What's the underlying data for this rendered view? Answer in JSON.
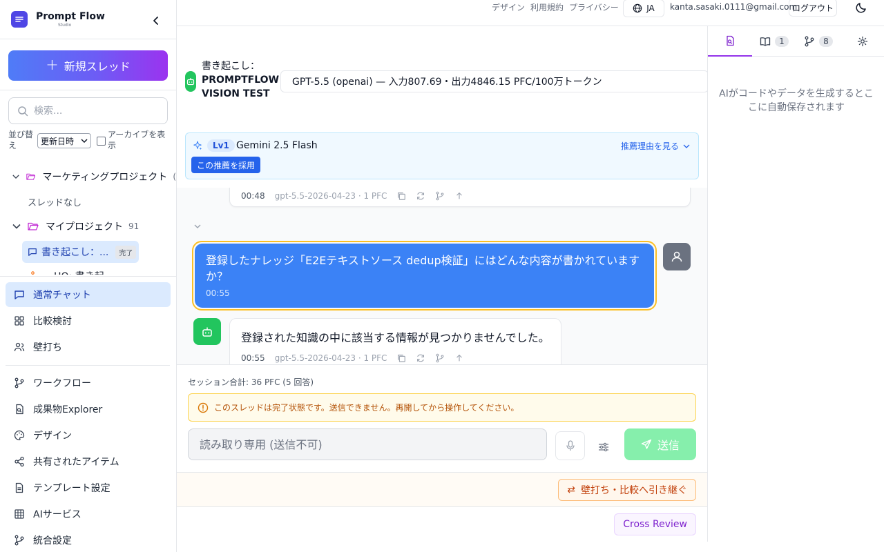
{
  "brand": {
    "name": "Prompt Flow",
    "sub": "Studio"
  },
  "sidebar": {
    "new_thread": "新規スレッド",
    "search_placeholder": "検索...",
    "sort_label": "並び替え",
    "sort_value": "更新日時",
    "archive_label": "アーカイブを表示",
    "tree": {
      "project1": {
        "name": "マーケティングプロジェクト",
        "suffix": "("
      },
      "project1_empty": "スレッドなし",
      "project2": {
        "name": "マイプロジェクト",
        "count": "91"
      },
      "active_thread": {
        "label": "書き起こし：...",
        "status": "完了"
      },
      "partial_row": "HQ: 書き起"
    },
    "nav": [
      {
        "label": "通常チャット",
        "icon": "chat-icon"
      },
      {
        "label": "比較検討",
        "icon": "grid-icon"
      },
      {
        "label": "壁打ち",
        "icon": "users-icon"
      },
      {
        "label": "ワークフロー",
        "icon": "workflow-icon"
      },
      {
        "label": "成果物Explorer",
        "icon": "file-search-icon"
      },
      {
        "label": "デザイン",
        "icon": "palette-icon"
      },
      {
        "label": "共有されたアイテム",
        "icon": "share-icon"
      },
      {
        "label": "テンプレート設定",
        "icon": "document-icon"
      },
      {
        "label": "AIサービス",
        "icon": "table-icon"
      },
      {
        "label": "統合設定",
        "icon": "branch-icon"
      }
    ]
  },
  "topbar": {
    "links": [
      "デザイン",
      "利用規約",
      "プライバシー"
    ],
    "lang": "JA",
    "email": "kanta.sasaki.0111@gmail.com",
    "logout": "ログアウト"
  },
  "thread": {
    "title_prefix": "書き起こし：",
    "title_main": "PROMPTFLOW VISION TEST",
    "model": "GPT-5.5 (openai) — 入力807.69・出力4846.15 PFC/100万トークン"
  },
  "recommendation": {
    "level": "Lv1",
    "model": "Gemini 2.5 Flash",
    "reason_link": "推薦理由を見る",
    "adopt": "この推薦を採用"
  },
  "messages": {
    "prev_meta": {
      "time": "00:48",
      "info": "gpt-5.5-2026-04-23 · 1 PFC"
    },
    "user": {
      "text": "登録したナレッジ「E2Eテキストソース dedup検証」にはどんな内容が書かれていますか？",
      "time": "00:55"
    },
    "bot": {
      "text": "登録された知識の中に該当する情報が見つかりませんでした。",
      "time": "00:55",
      "info": "gpt-5.5-2026-04-23 · 1 PFC"
    }
  },
  "composer": {
    "session_total": "セッション合計: 36 PFC (5 回答)",
    "warning": "このスレッドは完了状態です。送信できません。再開してから操作してください。",
    "placeholder": "読み取り専用 (送信不可)",
    "send": "送信",
    "handoff": "壁打ち・比較へ引き継ぐ",
    "cross_review": "Cross Review"
  },
  "right_panel": {
    "tab_knowledge_count": "1",
    "tab_branch_count": "8",
    "empty_message": "AIがコードやデータを生成するとここに自動保存されます"
  },
  "colors": {
    "accent": "#3b82f6",
    "brand": "#4f46e5",
    "success": "#22c55e",
    "warning": "#b45309",
    "highlight": "#fbbf24"
  }
}
